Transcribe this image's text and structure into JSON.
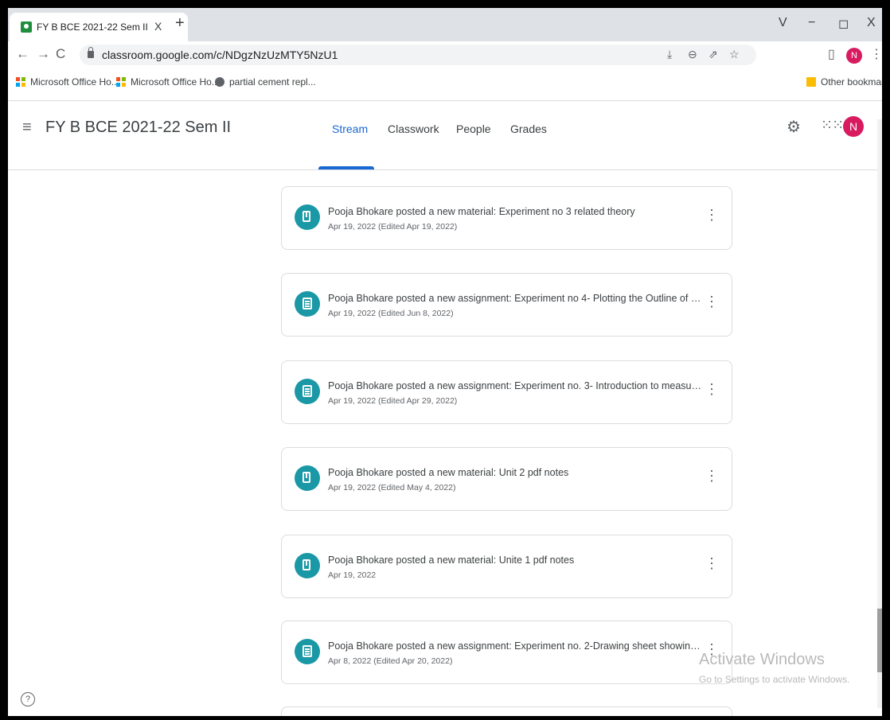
{
  "browser": {
    "tab_title": "FY B BCE 2021-22 Sem II",
    "tab_close": "X",
    "new_tab": "+",
    "window_controls": {
      "dropdown": "V",
      "minimize": "−",
      "restore": "◻",
      "close": "X"
    },
    "url": "classroom.google.com/c/NDgzNzUzMTY5NzU1",
    "profile_initial": "N",
    "bookmarks": [
      "Microsoft Office Ho...",
      "Microsoft Office Ho...",
      "partial cement repl..."
    ],
    "other_bookmarks": "Other bookmarks"
  },
  "app": {
    "class_title": "FY B BCE 2021-22 Sem II",
    "tabs": [
      "Stream",
      "Classwork",
      "People",
      "Grades"
    ],
    "active_tab": "Stream",
    "avatar_initial": "N"
  },
  "posts": [
    {
      "type": "material",
      "title": "Pooja Bhokare posted a new material: Experiment no 3 related theory",
      "date": "Apr 19, 2022 (Edited Apr 19, 2022)"
    },
    {
      "type": "assignment",
      "title": "Pooja Bhokare posted a new assignment: Experiment no 4- Plotting the Outline of building b...",
      "date": "Apr 19, 2022 (Edited Jun 8, 2022)"
    },
    {
      "type": "assignment",
      "title": "Pooja Bhokare posted a new assignment: Experiment no. 3- Introduction to measurement of ...",
      "date": "Apr 19, 2022 (Edited Apr 29, 2022)"
    },
    {
      "type": "material",
      "title": "Pooja Bhokare posted a new material: Unit 2 pdf notes",
      "date": "Apr 19, 2022 (Edited May 4, 2022)"
    },
    {
      "type": "material",
      "title": "Pooja Bhokare posted a new material: Unite 1 pdf notes",
      "date": "Apr 19, 2022"
    },
    {
      "type": "assignment",
      "title": "Pooja Bhokare posted a new assignment: Experiment no. 2-Drawing sheet showing various b...",
      "date": "Apr 8, 2022 (Edited Apr 20, 2022)"
    }
  ],
  "watermark": {
    "title": "Activate Windows",
    "subtitle": "Go to Settings to activate Windows."
  },
  "colors": {
    "accent": "#1967d2",
    "post_icon": "#1a98a6",
    "avatar": "#d81b60"
  }
}
